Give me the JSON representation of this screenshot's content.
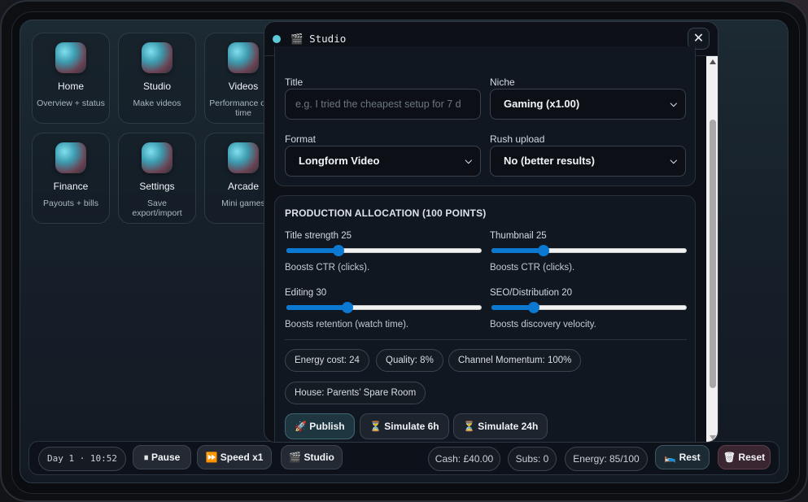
{
  "tiles": [
    {
      "name": "Home",
      "desc": "Overview + status",
      "icon": "home-icon"
    },
    {
      "name": "Studio",
      "desc": "Make videos",
      "icon": "studio-icon"
    },
    {
      "name": "Videos",
      "desc": "Performance over time",
      "icon": "videos-icon"
    },
    {
      "name": "Finance",
      "desc": "Payouts + bills",
      "icon": "finance-icon"
    },
    {
      "name": "Settings",
      "desc": "Save export/import",
      "icon": "settings-icon"
    },
    {
      "name": "Arcade",
      "desc": "Mini games",
      "icon": "arcade-icon"
    }
  ],
  "modal": {
    "title": "🎬 Studio",
    "close": "✕",
    "form": {
      "title_label": "Title",
      "title_placeholder": "e.g. I tried the cheapest setup for 7 d",
      "niche_label": "Niche",
      "niche_value": "Gaming (x1.00)",
      "format_label": "Format",
      "format_value": "Longform Video",
      "rush_label": "Rush upload",
      "rush_value": "No (better results)"
    },
    "allocation": {
      "heading": "PRODUCTION ALLOCATION (100 POINTS)",
      "sliders": [
        {
          "label": "Title strength 25",
          "value": 25,
          "max": 100,
          "hint": "Boosts CTR (clicks)."
        },
        {
          "label": "Thumbnail 25",
          "value": 25,
          "max": 100,
          "hint": "Boosts CTR (clicks)."
        },
        {
          "label": "Editing 30",
          "value": 30,
          "max": 100,
          "hint": "Boosts retention (watch time)."
        },
        {
          "label": "SEO/Distribution 20",
          "value": 20,
          "max": 100,
          "hint": "Boosts discovery velocity."
        }
      ],
      "stats": {
        "energy_cost": "Energy cost: 24",
        "quality": "Quality: 8%",
        "momentum": "Channel Momentum: 100%",
        "house": "House: Parents’ Spare Room"
      },
      "actions": {
        "publish": "🚀 Publish",
        "sim6": "⏳ Simulate 6h",
        "sim24": "⏳ Simulate 24h"
      }
    }
  },
  "bottombar": {
    "clock": "Day 1 · 10:52",
    "pause": "⏸ Pause",
    "speed": "⏩ Speed x1",
    "studio": "🎬 Studio",
    "cash": "Cash: £40.00",
    "subs": "Subs: 0",
    "energy": "Energy: 85/100",
    "rest": "🛌 Rest",
    "reset": "🗑 Reset"
  },
  "colors": {
    "accent": "#0b78d1",
    "teal": "#5ec8d8",
    "reset": "#3a2630"
  }
}
